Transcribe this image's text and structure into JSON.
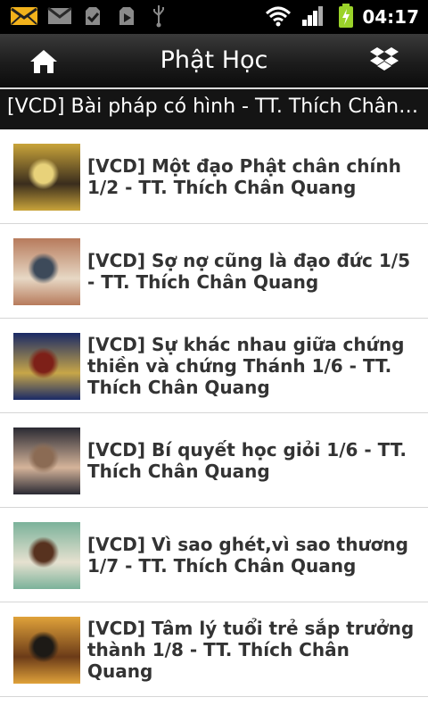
{
  "status_bar": {
    "time": "04:17",
    "icons": [
      "email-notification-icon",
      "gmail-icon",
      "download-done-icon",
      "play-store-icon",
      "usb-icon",
      "wifi-icon",
      "signal-icon",
      "battery-charging-icon"
    ]
  },
  "app_bar": {
    "title": "Phật Học",
    "home_icon": "home-icon",
    "dropbox_icon": "dropbox-icon"
  },
  "subheader": {
    "text": "[VCD] Bài pháp có hình - TT. Thích Chân Quang"
  },
  "items": [
    {
      "title": "[VCD] Một đạo Phật chân chính 1/2 - TT. Thích Chân Quang",
      "colors": [
        "#c9a43a",
        "#3a2d1d",
        "#e8d27a"
      ]
    },
    {
      "title": "[VCD] Sợ nợ cũng là đạo đức 1/5 - TT. Thích Chân Quang",
      "colors": [
        "#b77b5c",
        "#e7d8c5",
        "#3d4a5a"
      ]
    },
    {
      "title": "[VCD] Sự khác nhau giữa chứng thiền và chứng Thánh 1/6 - TT. Thích Chân Quang",
      "colors": [
        "#1a2a66",
        "#c7a648",
        "#7d2018"
      ]
    },
    {
      "title": "[VCD] Bí quyết học giỏi 1/6 - TT. Thích Chân Quang",
      "colors": [
        "#2a2a33",
        "#d5b49a",
        "#8b6b54"
      ]
    },
    {
      "title": "[VCD] Vì sao ghét,vì sao thương 1/7 - TT. Thích Chân Quang",
      "colors": [
        "#7bb29a",
        "#e6e1d0",
        "#57321f"
      ]
    },
    {
      "title": "[VCD] Tâm lý tuổi trẻ sắp trưởng thành 1/8 - TT. Thích Chân Quang",
      "colors": [
        "#e0a23a",
        "#6b3b18",
        "#1d1a16"
      ]
    }
  ]
}
